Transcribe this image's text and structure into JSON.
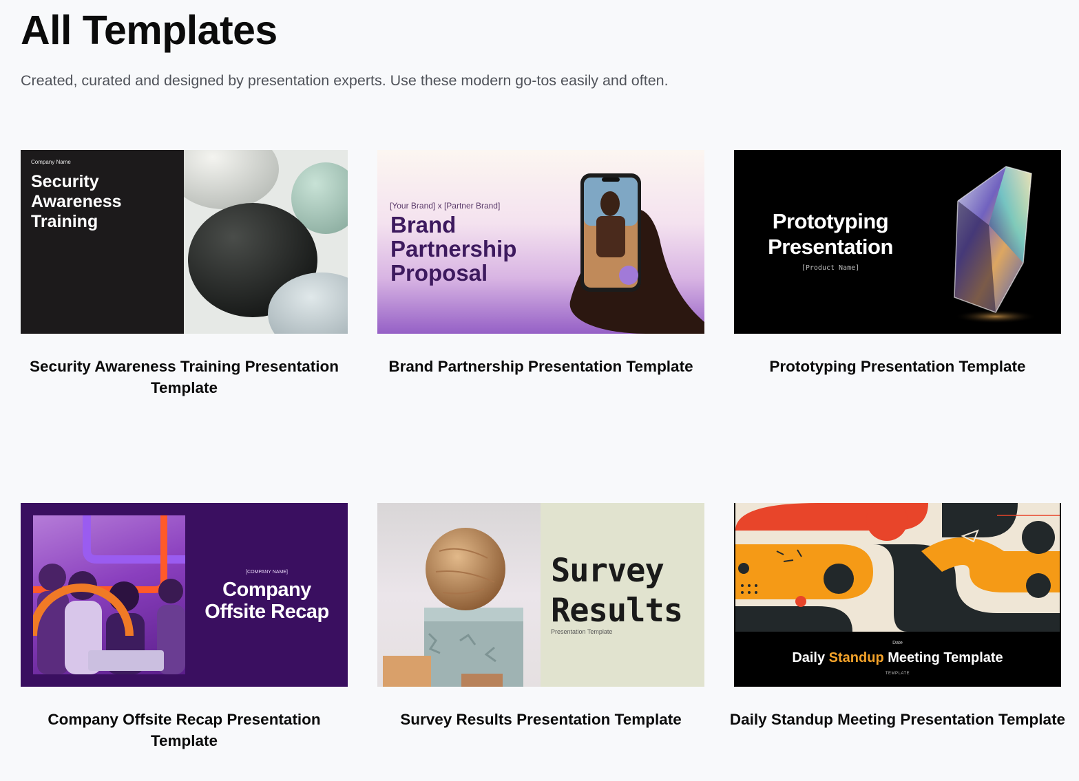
{
  "header": {
    "title": "All Templates",
    "subtitle": "Created, curated and designed by presentation experts. Use these modern go-tos easily and often."
  },
  "templates": [
    {
      "title": "Security Awareness Training Presentation Template",
      "thumb": {
        "small": "Company Name",
        "title": "Security Awareness Training"
      }
    },
    {
      "title": "Brand Partnership Presentation Template",
      "thumb": {
        "small": "[Your Brand] x [Partner Brand]",
        "title": "Brand Partnership Proposal"
      }
    },
    {
      "title": "Prototyping Presentation Template",
      "thumb": {
        "title": "Prototyping Presentation",
        "sub": "[Product Name]"
      }
    },
    {
      "title": "Company Offsite Recap Presentation Template",
      "thumb": {
        "small": "[COMPANY NAME]",
        "title": "Company Offsite Recap"
      }
    },
    {
      "title": "Survey Results Presentation Template",
      "thumb": {
        "title": "Survey Results",
        "sub": "Presentation Template"
      }
    },
    {
      "title": "Daily Standup Meeting Presentation Template",
      "thumb": {
        "date": "Date",
        "title_pre": "Daily ",
        "title_hl": "Standup",
        "title_post": " Meeting Template",
        "tag": "TEMPLATE"
      }
    }
  ],
  "colors": {
    "background": "#f8f9fb",
    "text": "#0b0b0b",
    "subtitle": "#50535a",
    "standup_highlight": "#f4a32a"
  }
}
